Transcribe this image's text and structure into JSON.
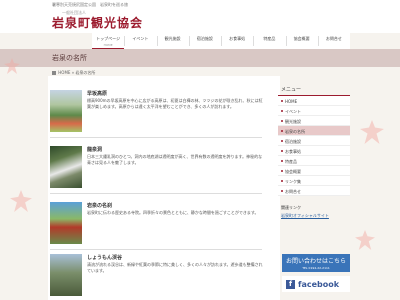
{
  "header": {
    "tagline": "暑寒別天売焼尻国定公園　岩泉町を巡る旅",
    "logo_sub": "一般社団法人",
    "logo": "岩泉町観光協会"
  },
  "nav": {
    "items": [
      {
        "label": "トップページ",
        "sub": "HOME",
        "active": true
      },
      {
        "label": "イベント",
        "sub": "",
        "active": false
      },
      {
        "label": "観光施設",
        "sub": "",
        "active": false
      },
      {
        "label": "宿泊施設",
        "sub": "",
        "active": false
      },
      {
        "label": "お食事処",
        "sub": "",
        "active": false
      },
      {
        "label": "特産品",
        "sub": "",
        "active": false
      },
      {
        "label": "協会概要",
        "sub": "",
        "active": false
      },
      {
        "label": "お問合せ",
        "sub": "",
        "active": false
      }
    ]
  },
  "page": {
    "title": "岩泉の名所",
    "breadcrumb_home": "HOME",
    "breadcrumb_sep": "»",
    "breadcrumb_current": "岩泉の名所"
  },
  "entries": [
    {
      "title": "早坂高原",
      "text": "標高900mの早坂高原を中心に広がる高原は、初夏は白樺の林、ツツジの花が咲き乱れ、秋には紅葉が楽しめます。高原からは遠く太平洋を望むことができ、多くの人が訪れます。"
    },
    {
      "title": "龍泉洞",
      "text": "日本三大鍾乳洞のひとつ。洞内の地底湖は透明度が高く、世界有数の透明度を誇ります。神秘的な青さは見る人を魅了します。"
    },
    {
      "title": "岩泉の名刹",
      "text": "岩泉町に伝わる歴史ある寺院。四季折々の景色とともに、静かな時間を過ごすことができます。"
    },
    {
      "title": "しょうもん渓谷",
      "text": "清流が流れる渓谷は、新緑や紅葉の季節に特に美しく、多くの人々が訪れます。遊歩道も整備されています。"
    }
  ],
  "sidebar": {
    "heading": "メニュー",
    "items": [
      {
        "label": "HOME",
        "active": false
      },
      {
        "label": "イベント",
        "active": false
      },
      {
        "label": "観光施設",
        "active": false
      },
      {
        "label": "岩泉の名所",
        "active": true
      },
      {
        "label": "宿泊施設",
        "active": false
      },
      {
        "label": "お食事処",
        "active": false
      },
      {
        "label": "特産品",
        "active": false
      },
      {
        "label": "協会概要",
        "active": false
      },
      {
        "label": "リンク集",
        "active": false
      },
      {
        "label": "お問合せ",
        "active": false
      }
    ],
    "links_heading": "関連リンク",
    "link": "岩泉町オフィシャルサイト"
  },
  "contact": {
    "title": "お問い合わせはこちら",
    "sub": "TEL 0194-22-2111"
  },
  "facebook": {
    "icon_letter": "f",
    "label": "facebook"
  },
  "colors": {
    "accent": "#9c1b2e",
    "header_band": "#d9c8c5",
    "petal": "#f3a7a0",
    "facebook": "#3b5998"
  }
}
